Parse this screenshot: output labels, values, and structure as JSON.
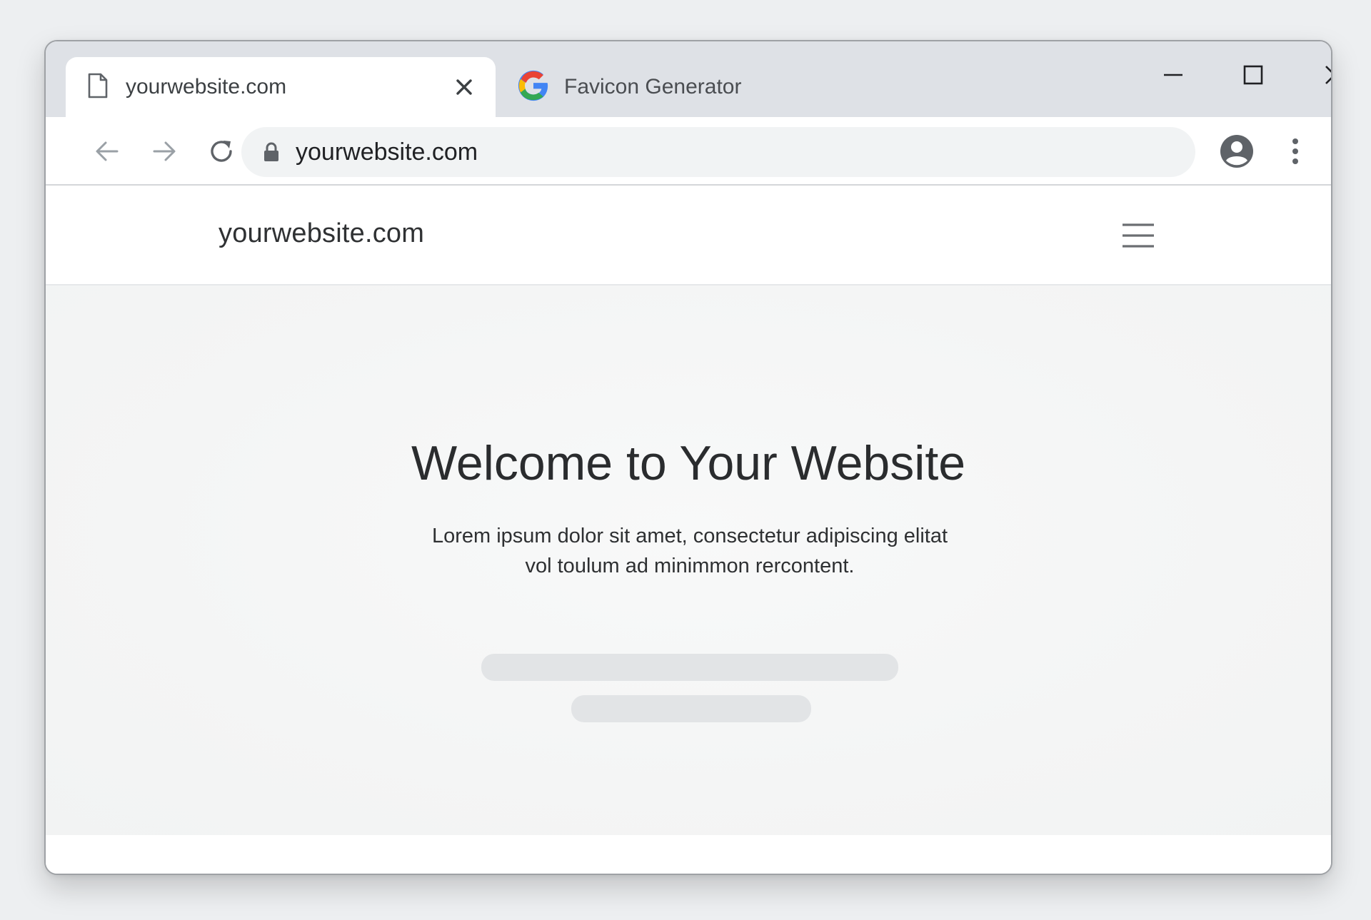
{
  "browser": {
    "tabs": [
      {
        "title": "yourwebsite.com",
        "icon": "document-icon",
        "active": true
      },
      {
        "title": "Favicon Generator",
        "icon": "google-g-icon",
        "active": false
      }
    ],
    "window_controls": [
      "minimize-icon",
      "maximize-icon",
      "close-icon"
    ],
    "address_bar": {
      "url": "yourwebsite.com",
      "icon": "lock-icon"
    },
    "toolbar_icons": [
      "back-arrow-icon",
      "forward-arrow-icon",
      "reload-icon",
      "account-icon",
      "more-vertical-icon"
    ]
  },
  "site": {
    "logo_text": "yourwebsite.com",
    "menu_icon": "hamburger-menu-icon",
    "hero": {
      "title": "Welcome to Your Website",
      "subtitle_line1": "Lorem ipsum dolor sit amet, consectetur adipiscing elitat",
      "subtitle_line2": "vol toulum ad minimmon rercontent."
    }
  },
  "colors": {
    "tabbar_bg": "#dee1e6",
    "omnibox_bg": "#f1f3f4",
    "page_bg": "#f6f7f7",
    "skeleton": "#e2e4e6",
    "google_blue": "#4285F4",
    "google_red": "#EA4335",
    "google_yellow": "#FBBC05",
    "google_green": "#34A853"
  }
}
